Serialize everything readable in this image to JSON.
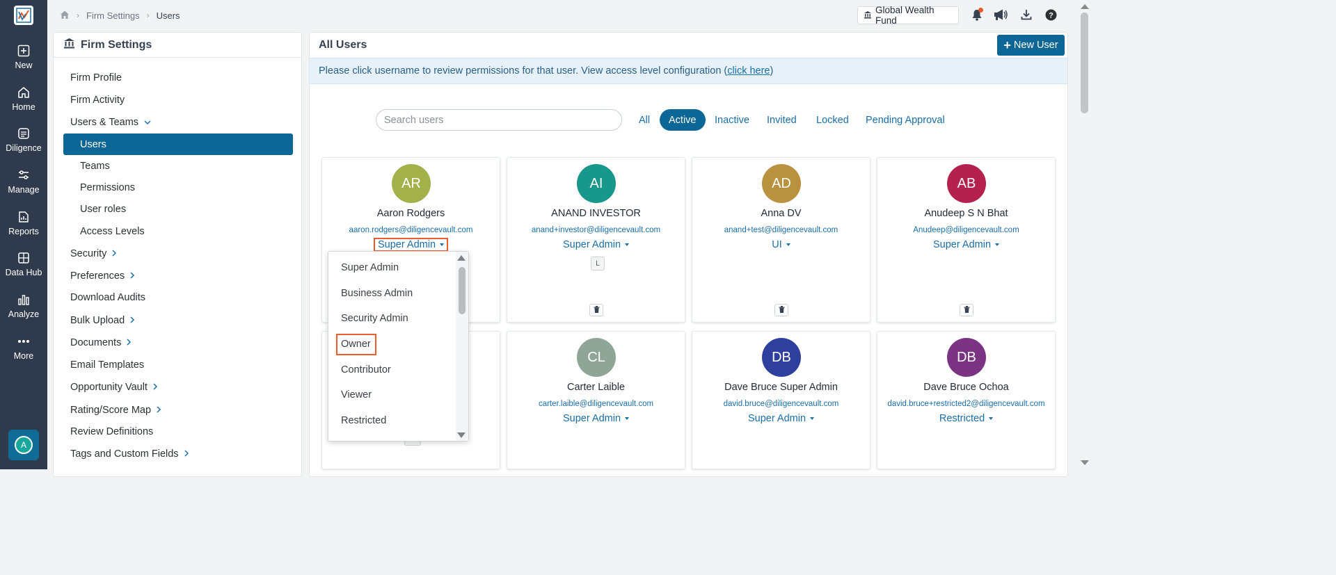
{
  "rail": {
    "items": [
      {
        "label": "New",
        "icon": "plus-square-icon"
      },
      {
        "label": "Home",
        "icon": "home-icon"
      },
      {
        "label": "Diligence",
        "icon": "diligence-icon"
      },
      {
        "label": "Manage",
        "icon": "sliders-icon"
      },
      {
        "label": "Reports",
        "icon": "reports-icon"
      },
      {
        "label": "Data Hub",
        "icon": "grid-icon"
      },
      {
        "label": "Analyze",
        "icon": "bar-chart-icon"
      },
      {
        "label": "More",
        "icon": "more-dots-icon"
      }
    ],
    "avatar_initial": "A"
  },
  "breadcrumb": {
    "items": [
      "Firm Settings",
      "Users"
    ]
  },
  "topbar": {
    "fund_label": "Global Wealth Fund"
  },
  "settings": {
    "title": "Firm Settings",
    "items": [
      {
        "label": "Firm Profile"
      },
      {
        "label": "Firm Activity"
      },
      {
        "label": "Users & Teams"
      },
      {
        "label": "Users"
      },
      {
        "label": "Teams"
      },
      {
        "label": "Permissions"
      },
      {
        "label": "User roles"
      },
      {
        "label": "Access Levels"
      },
      {
        "label": "Security"
      },
      {
        "label": "Preferences"
      },
      {
        "label": "Download Audits"
      },
      {
        "label": "Bulk Upload"
      },
      {
        "label": "Documents"
      },
      {
        "label": "Email Templates"
      },
      {
        "label": "Opportunity Vault"
      },
      {
        "label": "Rating/Score Map"
      },
      {
        "label": "Review Definitions"
      },
      {
        "label": "Tags and Custom Fields"
      }
    ]
  },
  "main": {
    "title": "All Users",
    "new_user_label": "New User",
    "info_text": "Please click username to review permissions for that user. View access level configuration (",
    "info_link": "click here ",
    "info_close": ")",
    "search_placeholder": "Search users",
    "filters": [
      "All",
      "Active",
      "Inactive",
      "Invited",
      "Locked",
      "Pending Approval"
    ],
    "active_filter": "Active"
  },
  "users": [
    {
      "initials": "AR",
      "name": "Aaron Rodgers",
      "email": "aaron.rodgers@diligencevault.com",
      "role": "Super Admin",
      "color": "#a3b14b"
    },
    {
      "initials": "AI",
      "name": "ANAND INVESTOR",
      "email": "anand+investor@diligencevault.com",
      "role": "Super Admin",
      "color": "#18978b",
      "badge": "L"
    },
    {
      "initials": "AD",
      "name": "Anna DV",
      "email": "anand+test@diligencevault.com",
      "role": "UI",
      "color": "#b9923f"
    },
    {
      "initials": "AB",
      "name": "Anudeep S N Bhat",
      "email": "Anudeep@diligencevault.com",
      "role": "Super Admin",
      "color": "#b5214f"
    },
    {
      "initials": "CL",
      "name": "Carter Laible",
      "email": "carter.laible@diligencevault.com",
      "role": "Super Admin",
      "color": "#8fa597"
    },
    {
      "initials": "DB",
      "name": "Dave Bruce Super Admin",
      "email": "david.bruce@diligencevault.com",
      "role": "Super Admin",
      "color": "#2e3f9e"
    },
    {
      "initials": "DB",
      "name": "Dave Bruce Ochoa",
      "email": "david.bruce+restricted2@diligencevault.com",
      "role": "Restricted",
      "color": "#7b3384"
    }
  ],
  "role_dropdown": {
    "options": [
      "Super Admin",
      "Business Admin",
      "Security Admin",
      "Owner",
      "Contributor",
      "Viewer",
      "Restricted"
    ],
    "highlighted": "Owner"
  }
}
